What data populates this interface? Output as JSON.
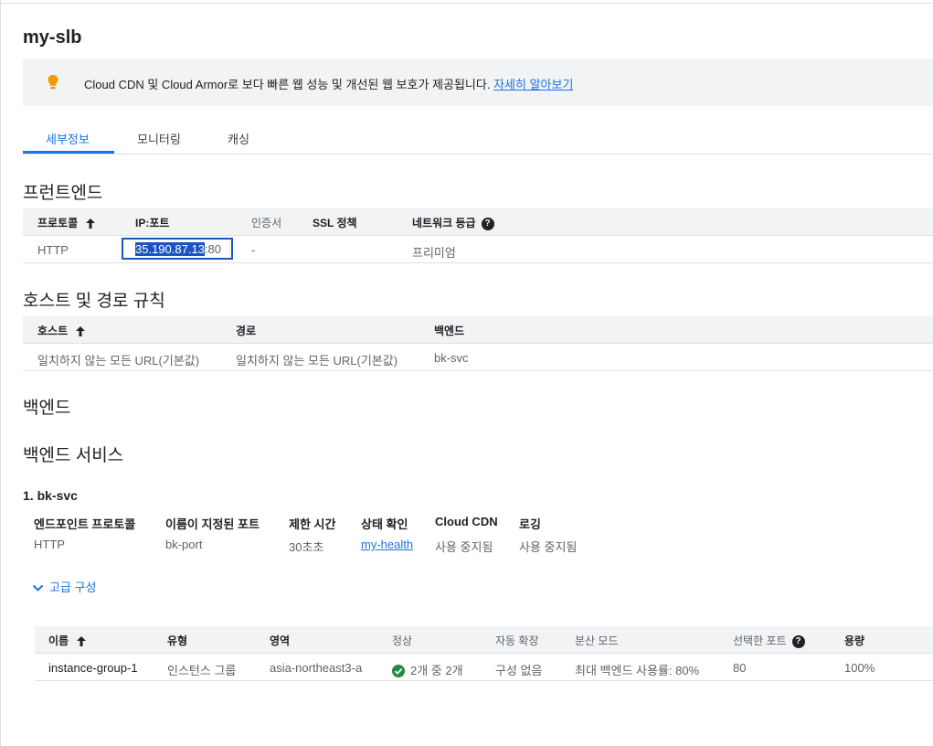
{
  "page": {
    "title": "my-slb"
  },
  "banner": {
    "icon": "lightbulb-icon",
    "message": "Cloud CDN 및 Cloud Armor로 보다 빠른 웹 성능 및 개선된 웹 보호가 제공됩니다.",
    "link": "자세히 알아보기"
  },
  "tabs": [
    {
      "label": "세부정보",
      "active": true
    },
    {
      "label": "모니터링",
      "active": false
    },
    {
      "label": "캐싱",
      "active": false
    }
  ],
  "frontend": {
    "heading": "프런트엔드",
    "columns": [
      "프로토콜",
      "IP:포트",
      "인증서",
      "SSL 정책",
      "네트워크 등급"
    ],
    "row": {
      "protocol": "HTTP",
      "ip_selected": "35.190.87.13",
      "port": ":80",
      "cert": "-",
      "ssl": "",
      "tier": "프리미엄"
    }
  },
  "host_rules": {
    "heading": "호스트 및 경로 규칙",
    "columns": [
      "호스트",
      "경로",
      "백엔드"
    ],
    "row": {
      "host": "일치하지 않는 모든 URL(기본값)",
      "path": "일치하지 않는 모든 URL(기본값)",
      "backend": "bk-svc"
    }
  },
  "backend": {
    "heading": "백엔드",
    "services_heading": "백엔드 서비스",
    "service_title": "1. bk-svc",
    "props": {
      "labels": [
        "엔드포인트 프로토콜",
        "이름이 지정된 포트",
        "제한 시간",
        "상태 확인",
        "Cloud CDN",
        "로깅"
      ],
      "values": [
        "HTTP",
        "bk-port",
        "30초초",
        "my-health",
        "사용 중지됨",
        "사용 중지됨"
      ]
    },
    "advanced_label": "고급 구성",
    "table": {
      "columns": [
        "이름",
        "유형",
        "영역",
        "정상",
        "자동 확장",
        "분산 모드",
        "선택한 포트",
        "용량"
      ],
      "row": [
        "instance-group-1",
        "인스턴스 그룹",
        "asia-northeast3-a",
        "2개 중 2개",
        "구성 없음",
        "최대 백엔드 사용률: 80%",
        "80",
        "100%"
      ]
    }
  },
  "colors": {
    "accent": "#1a73e8",
    "selection": "#1a56c0",
    "ok": "#1e8e3e",
    "banner_bg": "#f1f3f4"
  }
}
